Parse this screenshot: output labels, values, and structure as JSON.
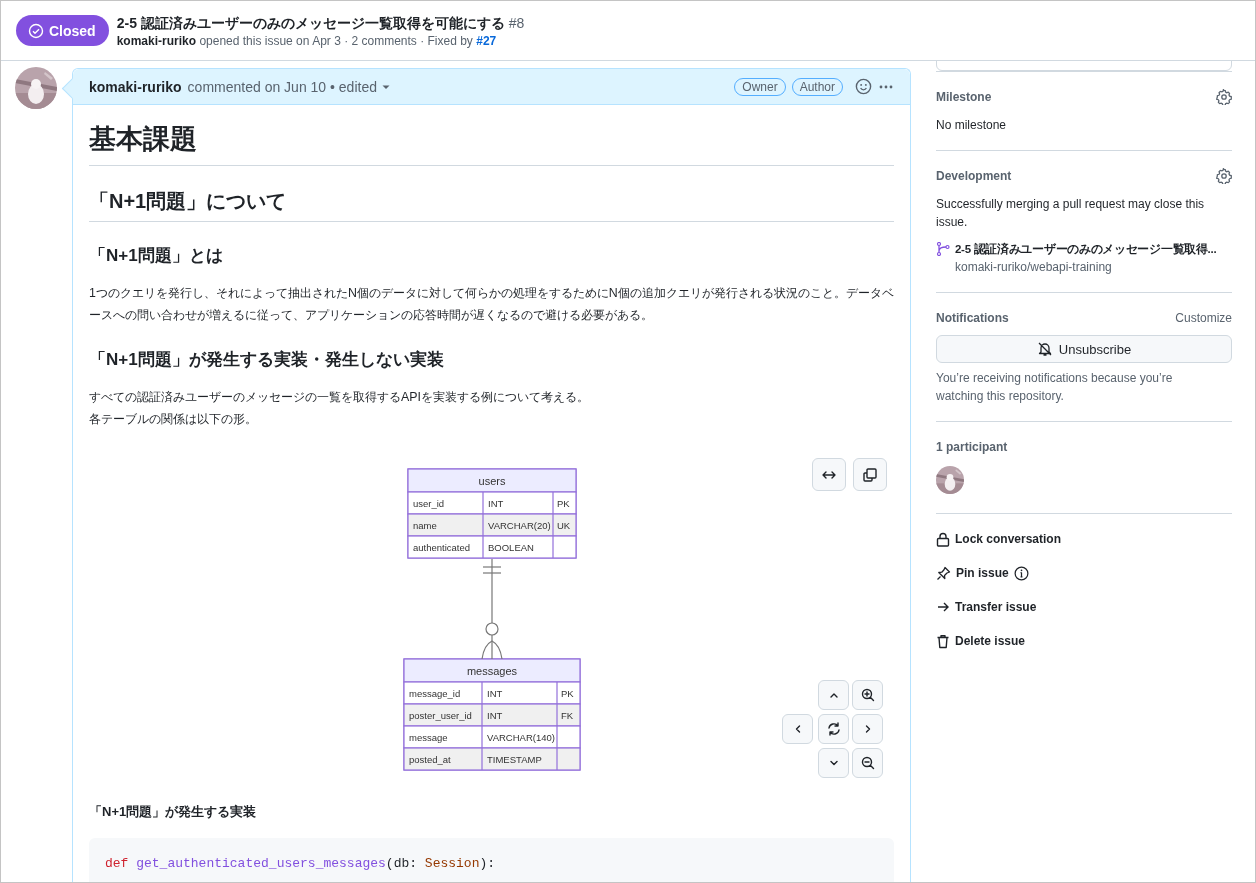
{
  "issue": {
    "state": {
      "kind": "closed",
      "label": "Closed"
    },
    "title": "2-5 認証済みユーザーのみのメッセージ一覧取得を可能にする",
    "number": "#8",
    "author": "komaki-ruriko",
    "meta": "opened this issue on Apr 3 · 2 comments · Fixed by",
    "fixed_by": "#27"
  },
  "comment": {
    "author": "komaki-ruriko",
    "meta": "commented on Jun 10 • edited",
    "badges": [
      "Owner",
      "Author"
    ],
    "blocks": [
      {
        "kind": "h1",
        "text": "基本課題"
      },
      {
        "kind": "h2",
        "text": "「N+1問題」について"
      },
      {
        "kind": "h3",
        "text": "「N+1問題」とは"
      },
      {
        "kind": "p",
        "lines": [
          "1つのクエリを発行し、それによって抽出されたN個のデータに対して何らかの処理をするためにN個の追加クエリが発行される状況のこと。データベースへの問い合わせが増えるに従って、アプリケーションの応答時間が遅くなるので避ける必要がある。"
        ]
      },
      {
        "kind": "h3",
        "text": "「N+1問題」が発生する実装・発生しない実装"
      },
      {
        "kind": "p",
        "lines": [
          "すべての認証済みユーザーのメッセージの一覧を取得するAPIを実装する例について考える。",
          "各テーブルの関係は以下の形。"
        ]
      },
      {
        "kind": "er_diagram",
        "entities": [
          {
            "name": "users",
            "fields": [
              {
                "name": "user_id",
                "type": "INT",
                "key": "PK"
              },
              {
                "name": "name",
                "type": "VARCHAR(20)",
                "key": "UK"
              },
              {
                "name": "authenticated",
                "type": "BOOLEAN"
              }
            ]
          },
          {
            "name": "messages",
            "fields": [
              {
                "name": "message_id",
                "type": "INT",
                "key": "PK"
              },
              {
                "name": "poster_user_id",
                "type": "INT",
                "key": "FK"
              },
              {
                "name": "message",
                "type": "VARCHAR(140)"
              },
              {
                "name": "posted_at",
                "type": "TIMESTAMP"
              }
            ]
          }
        ]
      },
      {
        "kind": "h4",
        "text": "「N+1問題」が発生する実装"
      },
      {
        "kind": "code",
        "lines": [
          [
            {
              "kind": "keyword",
              "text": "def"
            },
            {
              "kind": "function",
              "text": "get_authenticated_users_messages"
            },
            {
              "kind": "plain",
              "text": "(db: "
            },
            {
              "kind": "type",
              "text": "Session"
            },
            {
              "kind": "plain",
              "text": "):"
            }
          ]
        ]
      }
    ]
  },
  "sidebar": {
    "milestone": {
      "heading": "Milestone",
      "value": "No milestone"
    },
    "development": {
      "heading": "Development",
      "text": "Successfully merging a pull request may close this issue.",
      "linked": {
        "title": "2-5 認証済みユーザーのみのメッセージ一覧取得...",
        "repo": "komaki-ruriko/webapi-training"
      }
    },
    "notifications": {
      "heading": "Notifications",
      "customize": "Customize",
      "button": "Unsubscribe",
      "text": "You’re receiving notifications because you’re watching this repository."
    },
    "participants": {
      "heading": "1 participant"
    },
    "actions": [
      {
        "kind": "lock",
        "label": "Lock conversation",
        "info": false
      },
      {
        "kind": "pin",
        "label": "Pin issue",
        "info": true
      },
      {
        "kind": "transfer",
        "label": "Transfer issue",
        "info": false
      },
      {
        "kind": "delete",
        "label": "Delete issue",
        "info": false
      }
    ]
  }
}
